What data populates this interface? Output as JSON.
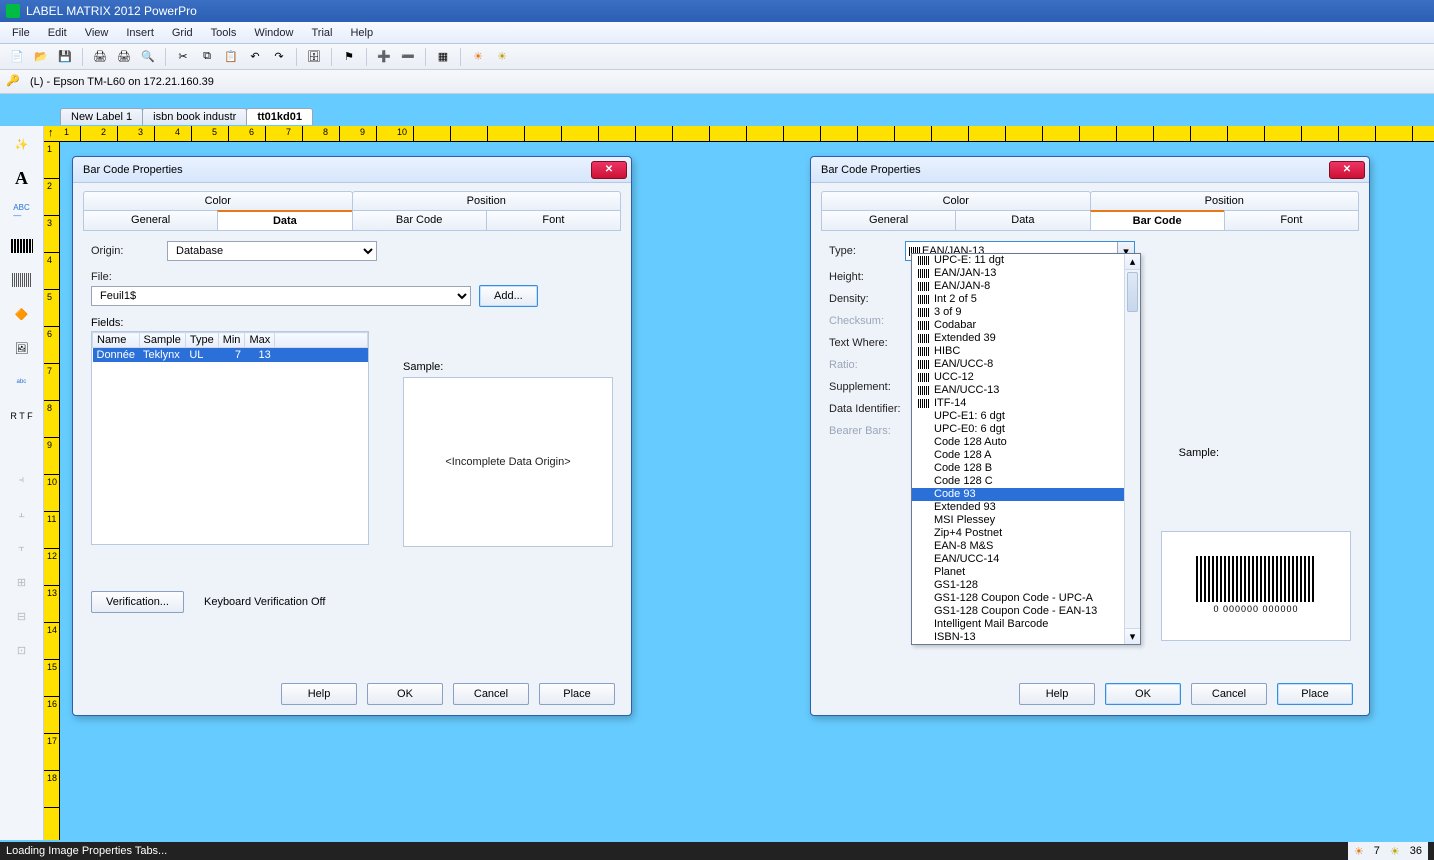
{
  "app": {
    "title": "LABEL MATRIX 2012 PowerPro"
  },
  "menu": {
    "items": [
      "File",
      "Edit",
      "View",
      "Insert",
      "Grid",
      "Tools",
      "Window",
      "Trial",
      "Help"
    ]
  },
  "info": {
    "printer": "(L) - Epson TM-L60 on 172.21.160.39"
  },
  "doctabs": {
    "t1": "New Label 1",
    "t2": "isbn book industr",
    "t3": "tt01kd01"
  },
  "ruler": {
    "h": [
      "1",
      "2",
      "3",
      "4",
      "5",
      "6",
      "7",
      "8",
      "9",
      "10"
    ],
    "v": [
      "1",
      "2",
      "3",
      "4",
      "5",
      "6",
      "7",
      "8",
      "9",
      "10",
      "11",
      "12",
      "13",
      "14",
      "15",
      "16",
      "17",
      "18"
    ]
  },
  "dlg1": {
    "title": "Bar Code Properties",
    "tabs_top": [
      "Color",
      "Position"
    ],
    "tabs_bot": [
      "General",
      "Data",
      "Bar Code",
      "Font"
    ],
    "active_tab": "Data",
    "origin_label": "Origin:",
    "origin_value": "Database",
    "file_label": "File:",
    "file_value": "Feuil1$",
    "add_btn": "Add...",
    "fields_label": "Fields:",
    "cols": [
      "Name",
      "Sample",
      "Type",
      "Min",
      "Max"
    ],
    "row": {
      "name": "Donnée",
      "sample": "Teklynx",
      "type": "UL",
      "min": "7",
      "max": "13"
    },
    "sample_label": "Sample:",
    "sample_text": "<Incomplete Data Origin>",
    "verify_btn": "Verification...",
    "verify_text": "Keyboard Verification Off",
    "buttons": {
      "help": "Help",
      "ok": "OK",
      "cancel": "Cancel",
      "place": "Place"
    }
  },
  "dlg2": {
    "title": "Bar Code Properties",
    "tabs_top": [
      "Color",
      "Position"
    ],
    "tabs_bot": [
      "General",
      "Data",
      "Bar Code",
      "Font"
    ],
    "active_tab": "Bar Code",
    "labels": {
      "type": "Type:",
      "height": "Height:",
      "density": "Density:",
      "checksum": "Checksum:",
      "textwhere": "Text Where:",
      "ratio": "Ratio:",
      "supplement": "Supplement:",
      "dataid": "Data Identifier:",
      "bearer": "Bearer Bars:",
      "sample": "Sample:"
    },
    "type_value": "EAN/JAN-13",
    "dropdown": {
      "selected": "Code 93",
      "with_icon": [
        "UPC-E: 11 dgt",
        "EAN/JAN-13",
        "EAN/JAN-8",
        "Int 2 of 5",
        "3 of 9",
        "Codabar",
        "Extended 39",
        "HIBC",
        "EAN/UCC-8",
        "UCC-12",
        "EAN/UCC-13",
        "ITF-14"
      ],
      "plain": [
        "UPC-E1: 6 dgt",
        "UPC-E0: 6 dgt",
        "Code 128 Auto",
        "Code 128 A",
        "Code 128 B",
        "Code 128 C",
        "Code 93",
        "Extended 93",
        "MSI Plessey",
        "Zip+4 Postnet",
        "EAN-8 M&S",
        "EAN/UCC-14",
        "Planet",
        "GS1-128",
        "GS1-128 Coupon Code - UPC-A",
        "GS1-128 Coupon Code - EAN-13",
        "Intelligent Mail Barcode",
        "ISBN-13"
      ]
    },
    "preview_caption": "0 000000 000000",
    "buttons": {
      "help": "Help",
      "ok": "OK",
      "cancel": "Cancel",
      "place": "Place"
    }
  },
  "status": {
    "left": "Loading Image Properties Tabs...",
    "r1": "7",
    "r2": "36"
  }
}
